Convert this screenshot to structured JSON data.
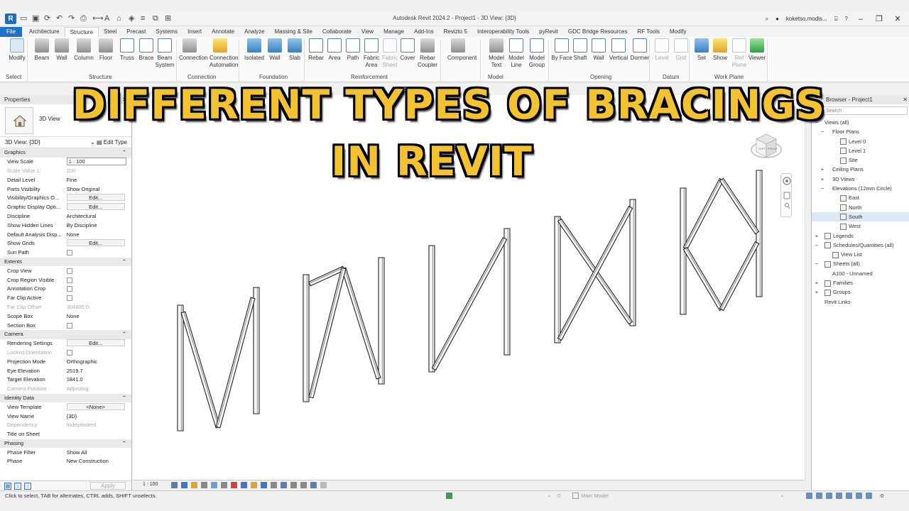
{
  "window": {
    "app_logo": "R",
    "title": "Autodesk Revit 2024.2 - Project1 - 3D View: {3D}",
    "user": "koketso.modis...",
    "help": "?"
  },
  "ribbon_tabs": [
    "File",
    "Architecture",
    "Structure",
    "Steel",
    "Precast",
    "Systems",
    "Insert",
    "Annotate",
    "Analyze",
    "Massing & Site",
    "Collaborate",
    "View",
    "Manage",
    "Add-Ins",
    "Revizto 5",
    "Interoperability Tools",
    "pyRevit",
    "GDC Bridge Resources",
    "RF Tools",
    "Modify"
  ],
  "ribbon": {
    "buttons": [
      {
        "label": "Modify",
        "icon": "cursor-icon",
        "style": "cursor"
      },
      {
        "label": "Beam",
        "icon": "beam-icon",
        "style": "grey"
      },
      {
        "label": "Wall",
        "icon": "wall-icon",
        "style": "grey"
      },
      {
        "label": "Column",
        "icon": "column-icon",
        "style": "grey"
      },
      {
        "label": "Floor",
        "icon": "floor-icon",
        "style": "grey"
      },
      {
        "label": "Truss",
        "icon": "truss-icon",
        "style": "outline"
      },
      {
        "label": "Brace",
        "icon": "brace-icon",
        "style": "outline"
      },
      {
        "label": "Beam System",
        "icon": "beam-system-icon",
        "style": "outline"
      },
      {
        "label": "Connection",
        "icon": "connection-icon",
        "style": "grey"
      },
      {
        "label": "Connection Automation",
        "icon": "connection-automation-icon",
        "style": "yellow"
      },
      {
        "label": "Isolated",
        "icon": "isolated-footing-icon",
        "style": "blue"
      },
      {
        "label": "Wall",
        "icon": "wall-foundation-icon",
        "style": "blue"
      },
      {
        "label": "Slab",
        "icon": "slab-icon",
        "style": "blue"
      },
      {
        "label": "Rebar",
        "icon": "rebar-icon",
        "style": "outline"
      },
      {
        "label": "Area",
        "icon": "area-rebar-icon",
        "style": "outline"
      },
      {
        "label": "Path",
        "icon": "path-rebar-icon",
        "style": "outline"
      },
      {
        "label": "Fabric Area",
        "icon": "fabric-area-icon",
        "style": "outline"
      },
      {
        "label": "Fabric Sheet",
        "icon": "fabric-sheet-icon",
        "style": "outline",
        "dim": true
      },
      {
        "label": "Cover",
        "icon": "cover-icon",
        "style": "outline"
      },
      {
        "label": "Rebar Coupler",
        "icon": "rebar-coupler-icon",
        "style": "grey"
      },
      {
        "label": "Component",
        "icon": "component-icon",
        "style": "grey"
      },
      {
        "label": "Model Text",
        "icon": "model-text-icon",
        "style": "grey"
      },
      {
        "label": "Model Line",
        "icon": "model-line-icon",
        "style": "outline"
      },
      {
        "label": "Model Group",
        "icon": "model-group-icon",
        "style": "outline"
      },
      {
        "label": "By Face",
        "icon": "opening-by-face-icon",
        "style": "outline"
      },
      {
        "label": "Shaft",
        "icon": "shaft-icon",
        "style": "outline"
      },
      {
        "label": "Wall",
        "icon": "wall-opening-icon",
        "style": "outline"
      },
      {
        "label": "Vertical",
        "icon": "vertical-opening-icon",
        "style": "outline"
      },
      {
        "label": "Dormer",
        "icon": "dormer-icon",
        "style": "outline"
      },
      {
        "label": "Level",
        "icon": "level-icon",
        "style": "outline",
        "dim": true
      },
      {
        "label": "Grid",
        "icon": "grid-icon",
        "style": "outline",
        "dim": true
      },
      {
        "label": "Set",
        "icon": "set-workplane-icon",
        "style": "blue"
      },
      {
        "label": "Show",
        "icon": "show-workplane-icon",
        "style": "yellow"
      },
      {
        "label": "Ref Plane",
        "icon": "ref-plane-icon",
        "style": "outline",
        "dim": true
      },
      {
        "label": "Viewer",
        "icon": "viewer-icon",
        "style": "green"
      }
    ],
    "panels": [
      "Select",
      "Structure",
      "Connection",
      "Foundation",
      "Reinforcement",
      "Model",
      "Opening",
      "Datum",
      "Work Plane"
    ]
  },
  "properties": {
    "title": "Properties",
    "type_name": "3D View",
    "selector": "3D View: {3D}",
    "edit_type": "Edit Type",
    "groups": [
      {
        "name": "Graphics",
        "rows": [
          {
            "label": "View Scale",
            "value": "1 : 100",
            "kind": "input"
          },
          {
            "label": "Scale Value    1:",
            "value": "100",
            "disabled": true
          },
          {
            "label": "Detail Level",
            "value": "Fine"
          },
          {
            "label": "Parts Visibility",
            "value": "Show Original"
          },
          {
            "label": "Visibility/Graphics O...",
            "value": "Edit...",
            "kind": "button"
          },
          {
            "label": "Graphic Display Opti...",
            "value": "Edit...",
            "kind": "button"
          },
          {
            "label": "Discipline",
            "value": "Architectural"
          },
          {
            "label": "Show Hidden Lines",
            "value": "By Discipline"
          },
          {
            "label": "Default Analysis Disp...",
            "value": "None"
          },
          {
            "label": "Show Grids",
            "value": "Edit...",
            "kind": "button"
          },
          {
            "label": "Sun Path",
            "value": "",
            "kind": "check"
          }
        ]
      },
      {
        "name": "Extents",
        "rows": [
          {
            "label": "Crop View",
            "value": "",
            "kind": "check"
          },
          {
            "label": "Crop Region Visible",
            "value": "",
            "kind": "check"
          },
          {
            "label": "Annotation Crop",
            "value": "",
            "kind": "check"
          },
          {
            "label": "Far Clip Active",
            "value": "",
            "kind": "check"
          },
          {
            "label": "Far Clip Offset",
            "value": "304800.0",
            "disabled": true
          },
          {
            "label": "Scope Box",
            "value": "None"
          },
          {
            "label": "Section Box",
            "value": "",
            "kind": "check"
          }
        ]
      },
      {
        "name": "Camera",
        "rows": [
          {
            "label": "Rendering Settings",
            "value": "Edit...",
            "kind": "button"
          },
          {
            "label": "Locked Orientation",
            "value": "",
            "kind": "check",
            "disabled": true
          },
          {
            "label": "Projection Mode",
            "value": "Orthographic"
          },
          {
            "label": "Eye Elevation",
            "value": "2519.7"
          },
          {
            "label": "Target Elevation",
            "value": "1841.0"
          },
          {
            "label": "Camera Position",
            "value": "Adjusting",
            "disabled": true
          }
        ]
      },
      {
        "name": "Identity Data",
        "rows": [
          {
            "label": "View Template",
            "value": "<None>",
            "kind": "button"
          },
          {
            "label": "View Name",
            "value": "{3D}"
          },
          {
            "label": "Dependency",
            "value": "Independent",
            "disabled": true
          },
          {
            "label": "Title on Sheet",
            "value": ""
          }
        ]
      },
      {
        "name": "Phasing",
        "rows": [
          {
            "label": "Phase Filter",
            "value": "Show All"
          },
          {
            "label": "Phase",
            "value": "New Construction"
          }
        ]
      }
    ],
    "apply": "Apply"
  },
  "overlay": {
    "line1": "DIFFERENT TYPES OF BRACINGS",
    "line2": "IN REVIT",
    "color": "#f2c230"
  },
  "viewcube": {
    "left": "LEFT",
    "front": "FRONT"
  },
  "browser": {
    "title": "Browser - Project1",
    "search_placeholder": "Search",
    "items": [
      {
        "label": "Views (all)",
        "tog": "−",
        "indent": 0
      },
      {
        "label": "Floor Plans",
        "tog": "−",
        "indent": 1
      },
      {
        "label": "Level 0",
        "indent": 2,
        "icon": true
      },
      {
        "label": "Level 1",
        "indent": 2,
        "icon": true
      },
      {
        "label": "Site",
        "indent": 2,
        "icon": true
      },
      {
        "label": "Ceiling Plans",
        "tog": "+",
        "indent": 1
      },
      {
        "label": "3D Views",
        "tog": "+",
        "indent": 1
      },
      {
        "label": "Elevations (12mm Circle)",
        "tog": "−",
        "indent": 1
      },
      {
        "label": "East",
        "indent": 2,
        "icon": true
      },
      {
        "label": "North",
        "indent": 2,
        "icon": true
      },
      {
        "label": "South",
        "indent": 2,
        "icon": true,
        "selected": true
      },
      {
        "label": "West",
        "indent": 2,
        "icon": true
      },
      {
        "label": "Legends",
        "tog": "+",
        "indent": 0,
        "icon": true
      },
      {
        "label": "Schedules/Quantities (all)",
        "tog": "−",
        "indent": 0,
        "icon": true
      },
      {
        "label": "View List",
        "indent": 1,
        "icon": true
      },
      {
        "label": "Sheets (all)",
        "tog": "−",
        "indent": 0,
        "icon": true
      },
      {
        "label": "A100 - Unnamed",
        "indent": 1
      },
      {
        "label": "Families",
        "tog": "+",
        "indent": 0,
        "icon": true
      },
      {
        "label": "Groups",
        "tog": "+",
        "indent": 0,
        "icon": true
      },
      {
        "label": "Revit Links",
        "indent": 0
      }
    ]
  },
  "viewbar": {
    "scale": "1 : 100"
  },
  "statusbar": {
    "message": "Click to select, TAB for alternates, CTRL adds, SHIFT unselects.",
    "filter_count": ":0",
    "model": "Main Model",
    "select_count": ":0"
  }
}
